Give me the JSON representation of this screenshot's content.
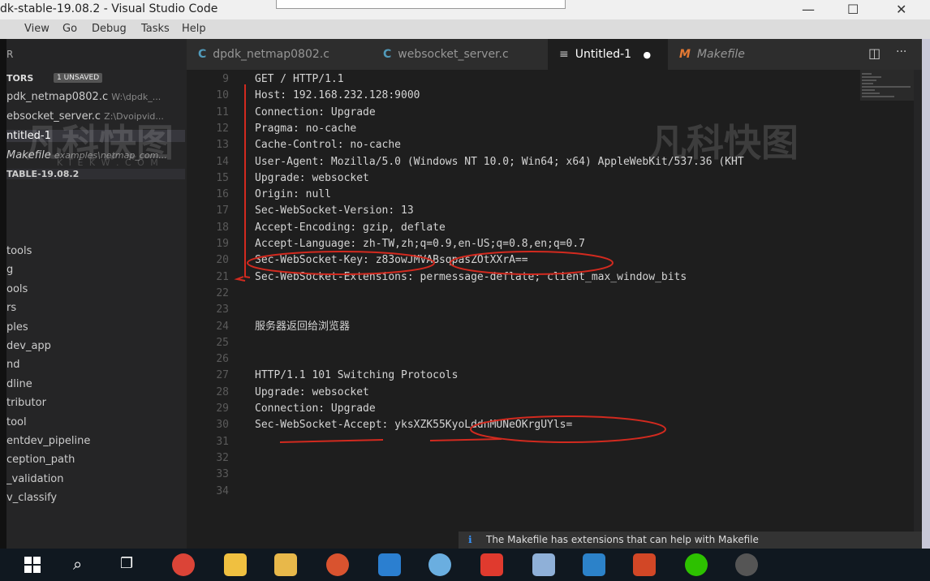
{
  "window": {
    "title": "dk-stable-19.08.2 - Visual Studio Code",
    "minimize": "—",
    "maximize": "☐",
    "close": "✕"
  },
  "menu": [
    "View",
    "Go",
    "Debug",
    "Tasks",
    "Help"
  ],
  "sidebar": {
    "top_label": "R",
    "section_label": "TORS",
    "unsaved_badge": "1 UNSAVED",
    "open_editors": [
      {
        "name": "pdk_netmap0802.c",
        "path": "W:\\dpdk_..."
      },
      {
        "name": "ebsocket_server.c",
        "path": "Z:\\Dvoipvid..."
      },
      {
        "name": "ntitled-1",
        "path": ""
      },
      {
        "name": "Makefile",
        "path": "examples\\netmap_com..."
      }
    ],
    "folder": "TABLE-19.08.2",
    "tree": [
      "tools",
      "g",
      "ools",
      "rs",
      "ples",
      "dev_app",
      "nd",
      "dline",
      "tributor",
      "tool",
      "entdev_pipeline",
      "ception_path",
      "_validation",
      "v_classify"
    ]
  },
  "tabs": [
    {
      "icon": "C",
      "label": "dpdk_netmap0802.c"
    },
    {
      "icon": "C",
      "label": "websocket_server.c"
    },
    {
      "icon": "≡",
      "label": "Untitled-1",
      "dirty": "●"
    },
    {
      "icon": "M",
      "label": "Makefile"
    }
  ],
  "tab_actions": {
    "split": "◫",
    "more": "···"
  },
  "code": [
    {
      "n": "9",
      "t": "GET / HTTP/1.1"
    },
    {
      "n": "10",
      "t": "Host: 192.168.232.128:9000"
    },
    {
      "n": "11",
      "t": "Connection: Upgrade"
    },
    {
      "n": "12",
      "t": "Pragma: no-cache"
    },
    {
      "n": "13",
      "t": "Cache-Control: no-cache"
    },
    {
      "n": "14",
      "t": "User-Agent: Mozilla/5.0 (Windows NT 10.0; Win64; x64) AppleWebKit/537.36 (KHT"
    },
    {
      "n": "15",
      "t": "Upgrade: websocket"
    },
    {
      "n": "16",
      "t": "Origin: null"
    },
    {
      "n": "17",
      "t": "Sec-WebSocket-Version: 13"
    },
    {
      "n": "18",
      "t": "Accept-Encoding: gzip, deflate"
    },
    {
      "n": "19",
      "t": "Accept-Language: zh-TW,zh;q=0.9,en-US;q=0.8,en;q=0.7"
    },
    {
      "n": "20",
      "t": "Sec-WebSocket-Key: z83owJMVABsqpasZOtXXrA=="
    },
    {
      "n": "21",
      "t": "Sec-WebSocket-Extensions: permessage-deflate; client_max_window_bits"
    },
    {
      "n": "22",
      "t": ""
    },
    {
      "n": "23",
      "t": ""
    },
    {
      "n": "24",
      "t": "服务器返回给浏览器"
    },
    {
      "n": "25",
      "t": ""
    },
    {
      "n": "26",
      "t": ""
    },
    {
      "n": "27",
      "t": "HTTP/1.1 101 Switching Protocols"
    },
    {
      "n": "28",
      "t": "Upgrade: websocket"
    },
    {
      "n": "29",
      "t": "Connection: Upgrade"
    },
    {
      "n": "30",
      "t": "Sec-WebSocket-Accept: yksXZK55KyoLddnMUNeOKrgUYls="
    },
    {
      "n": "31",
      "t": ""
    },
    {
      "n": "32",
      "t": ""
    },
    {
      "n": "33",
      "t": ""
    },
    {
      "n": "34",
      "t": ""
    }
  ],
  "watermark": {
    "left": "凡科快图",
    "left_sub": "K  I  E  K  W  .  C  O  M",
    "right": "凡科快图"
  },
  "notification": "The Makefile has extensions that can help with Makefile",
  "colors": {
    "annotation": "#d22a1f",
    "accent": "#007acc"
  }
}
